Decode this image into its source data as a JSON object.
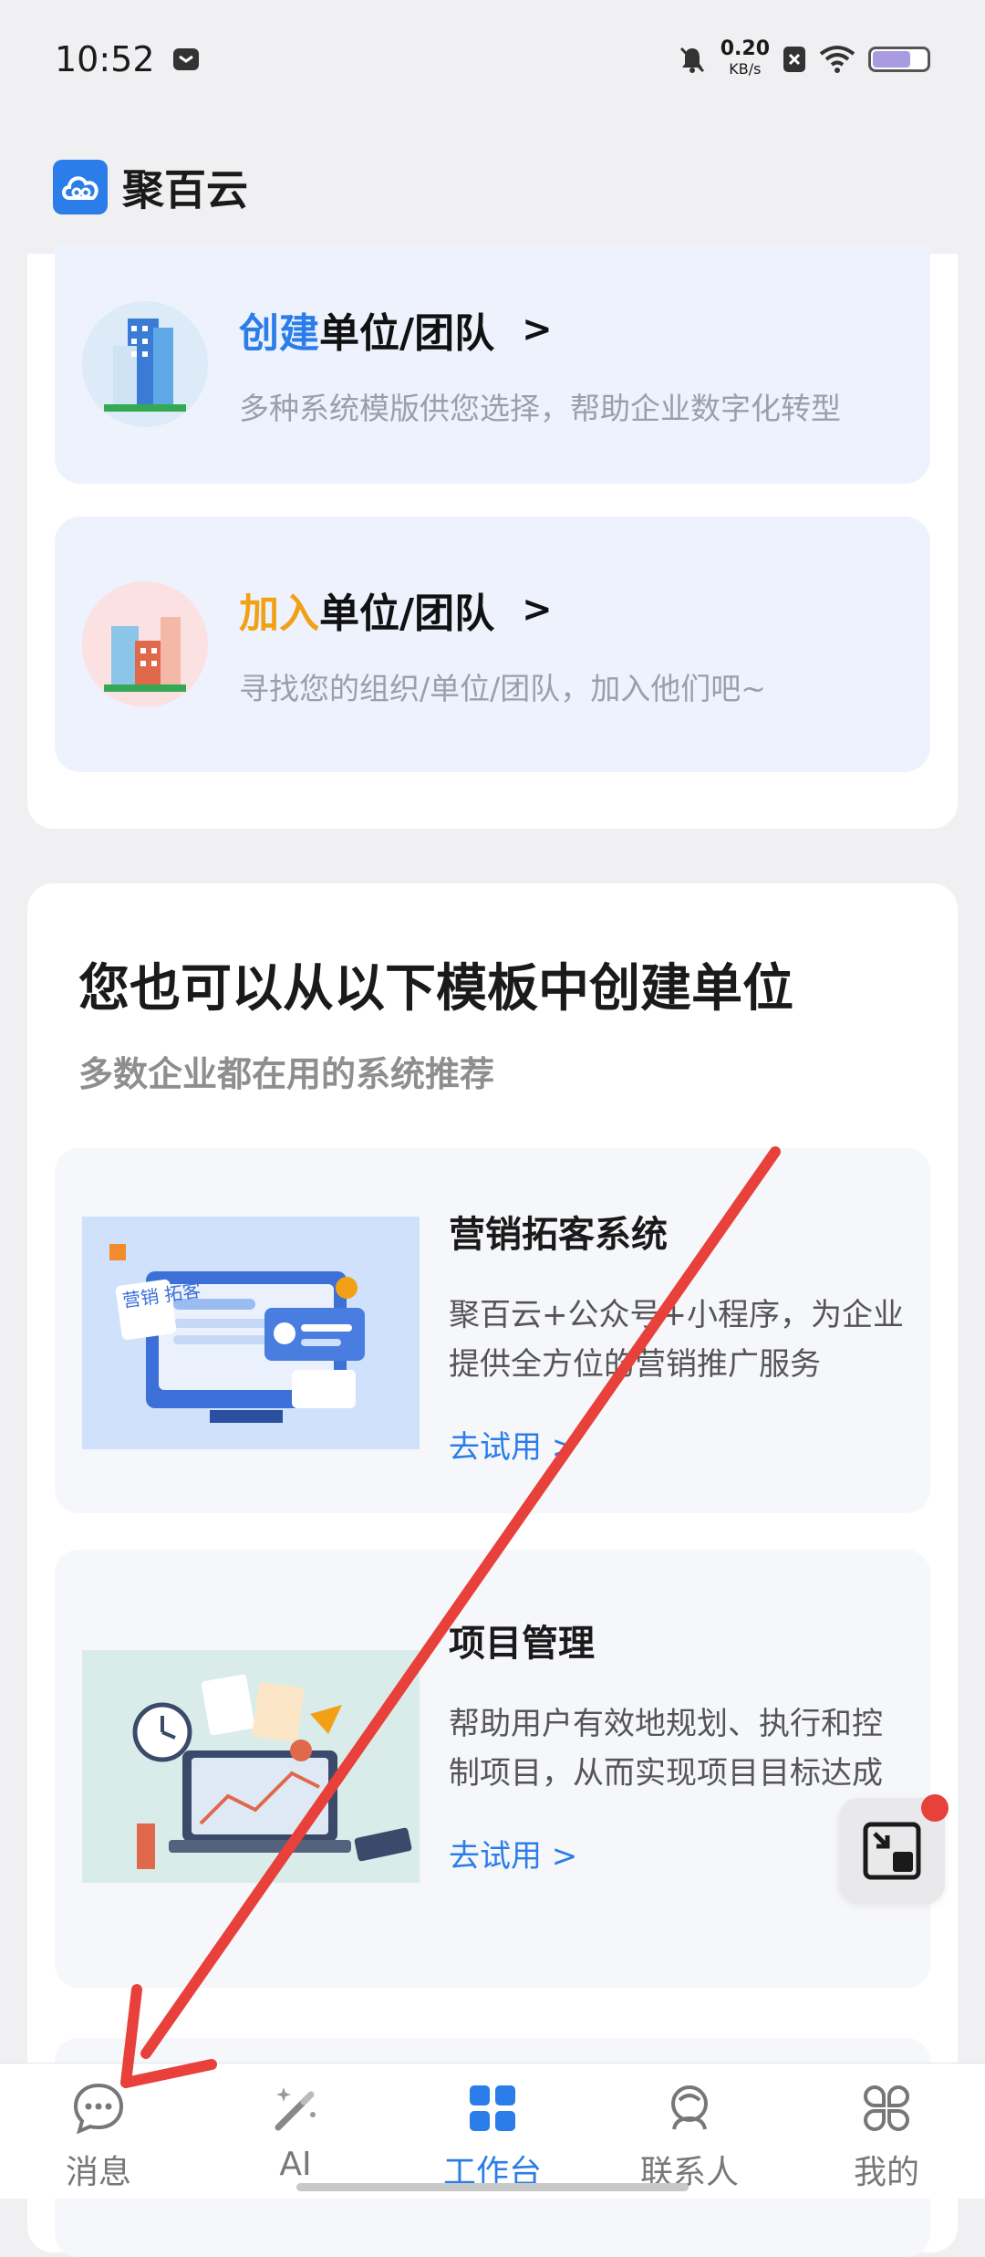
{
  "status_bar": {
    "time": "10:52",
    "net_speed_value": "0.20",
    "net_speed_unit": "KB/s"
  },
  "header": {
    "app_name": "聚百云"
  },
  "org_cards": {
    "create": {
      "accent": "创建",
      "title_rest": "单位/团队",
      "chevron": ">",
      "desc": "多种系统模版供您选择，帮助企业数字化转型"
    },
    "join": {
      "accent": "加入",
      "title_rest": "单位/团队",
      "chevron": ">",
      "desc": "寻找您的组织/单位/团队，加入他们吧~"
    }
  },
  "templates": {
    "heading": "您也可以从以下模板中创建单位",
    "subheading": "多数企业都在用的系统推荐",
    "items": [
      {
        "name": "营销拓客系统",
        "desc": "聚百云+公众号+小程序，为企业提供全方位的营销推广服务",
        "link": "去试用 >",
        "image_text": "营销 拓客"
      },
      {
        "name": "项目管理",
        "desc": "帮助用户有效地规划、执行和控制项目，从而实现项目目标达成",
        "link": "去试用 >"
      }
    ]
  },
  "tab_bar": {
    "tabs": [
      {
        "label": "消息",
        "icon": "chat-bubble-icon"
      },
      {
        "label": "AI",
        "icon": "magic-wand-icon"
      },
      {
        "label": "工作台",
        "icon": "grid-icon",
        "active": true
      },
      {
        "label": "联系人",
        "icon": "contacts-icon"
      },
      {
        "label": "我的",
        "icon": "clover-icon"
      }
    ]
  },
  "colors": {
    "brand_blue": "#2b7de9",
    "accent_orange": "#f2a116",
    "annotation_red": "#e8403a"
  }
}
